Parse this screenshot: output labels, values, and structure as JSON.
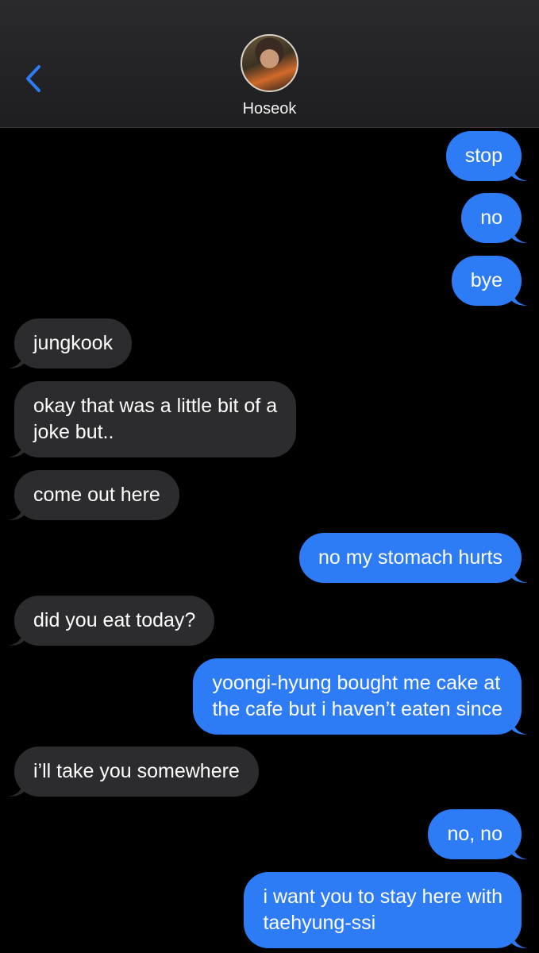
{
  "header": {
    "contact_name": "Hoseok",
    "back_icon": "chevron-left-icon"
  },
  "colors": {
    "outgoing_bubble": "#2d7cf6",
    "incoming_bubble": "#2c2c2e",
    "accent": "#2d7cf6",
    "background": "#000000"
  },
  "messages": [
    {
      "direction": "outgoing",
      "text": "stop"
    },
    {
      "direction": "outgoing",
      "text": "no"
    },
    {
      "direction": "outgoing",
      "text": "bye"
    },
    {
      "direction": "incoming",
      "text": "jungkook"
    },
    {
      "direction": "incoming",
      "lines": [
        "okay that was a little bit of a",
        "joke but.."
      ]
    },
    {
      "direction": "incoming",
      "text": "come out here"
    },
    {
      "direction": "outgoing",
      "text": "no my stomach hurts"
    },
    {
      "direction": "incoming",
      "text": "did you eat today?"
    },
    {
      "direction": "outgoing",
      "lines": [
        "yoongi-hyung bought me cake at",
        "the cafe but i haven’t eaten since"
      ]
    },
    {
      "direction": "incoming",
      "text": "i’ll take you somewhere"
    },
    {
      "direction": "outgoing",
      "text": "no, no"
    },
    {
      "direction": "outgoing",
      "lines": [
        "i want you to stay here with",
        "taehyung-ssi"
      ]
    }
  ]
}
